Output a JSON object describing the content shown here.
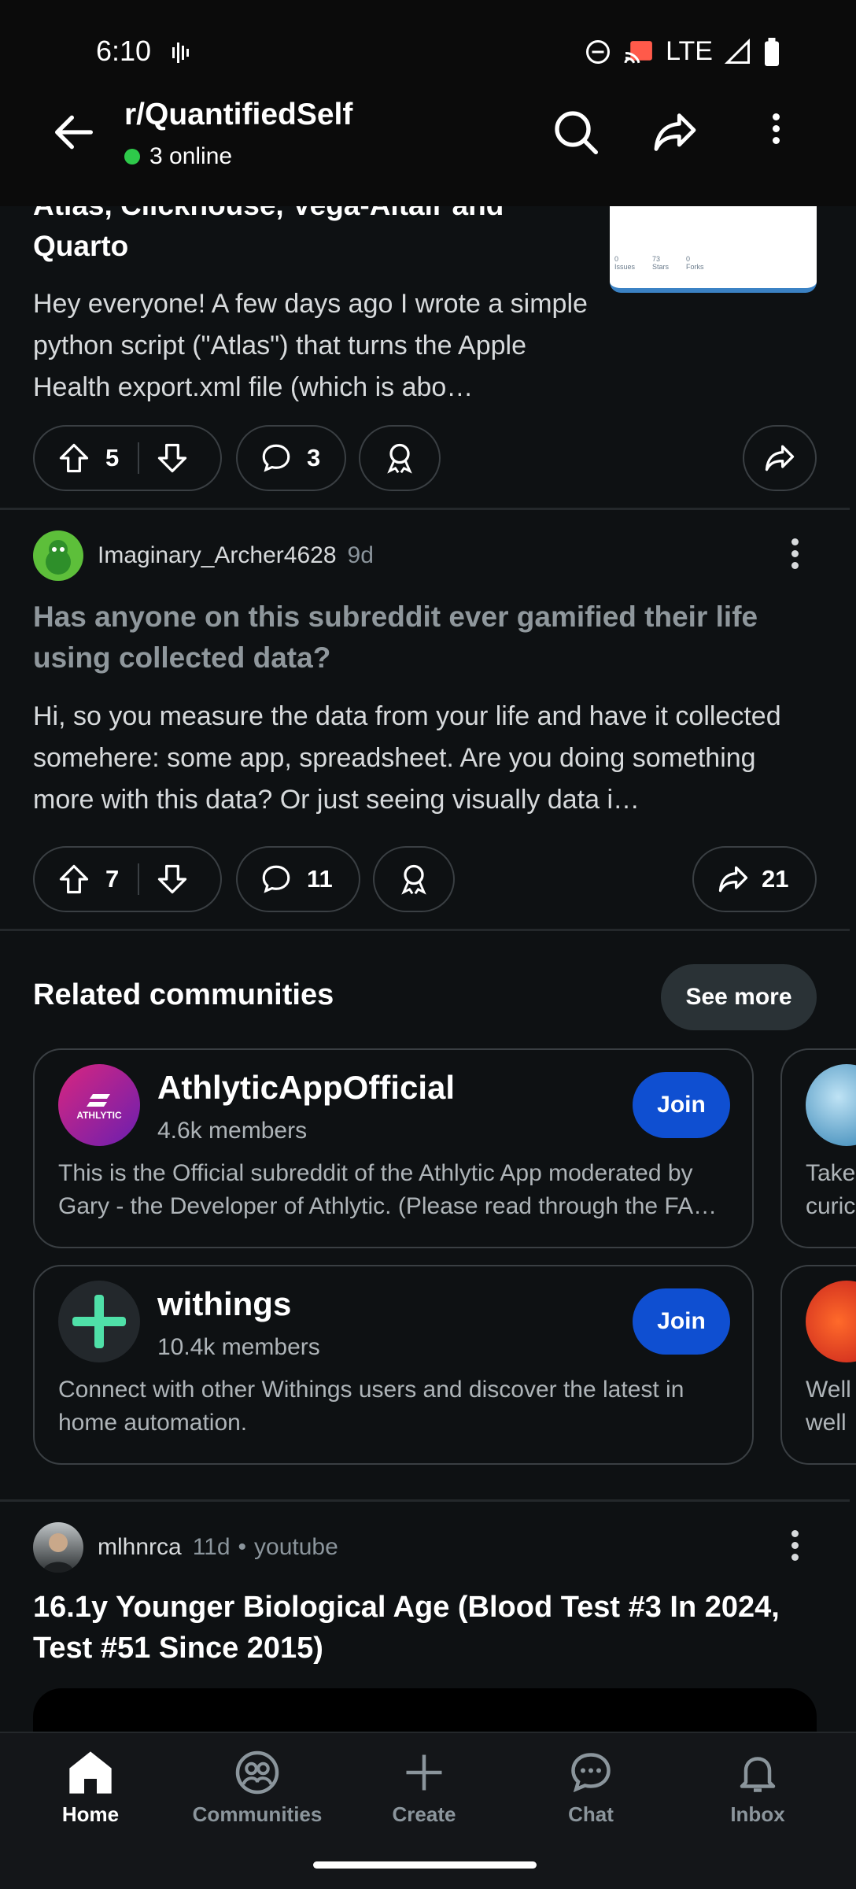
{
  "status": {
    "time": "6:10",
    "network": "LTE"
  },
  "header": {
    "title": "r/QuantifiedSelf",
    "online": "3 online"
  },
  "post1": {
    "title_visible": "Atlas, Clickhouse, Vega-Altair and",
    "title_line2": "Quarto",
    "body": "Hey everyone! A few days ago I wrote a simple python script (\"Atlas\") that turns the Apple Health export.xml file (which is abo…",
    "upvotes": "5",
    "comments": "3",
    "thumb_meta": {
      "a": "0",
      "b": "73",
      "c": "0",
      "l1": "Issues",
      "l2": "Stars",
      "l3": "Forks"
    }
  },
  "post2": {
    "user": "Imaginary_Archer4628",
    "age": "9d",
    "title": "Has anyone on this subreddit ever gamified their life using collected data?",
    "body": "Hi, so you measure the data from your life and have it collected somehere: some app, spreadsheet. Are you doing something more with this data? Or just seeing visually data i…",
    "upvotes": "7",
    "comments": "11",
    "shares": "21"
  },
  "related": {
    "title": "Related communities",
    "see_more": "See more",
    "communities": [
      {
        "name": "AthlyticAppOfficial",
        "members": "4.6k members",
        "desc": "This is the Official subreddit of the Athlytic App moderated by Gary - the Developer of Athlytic.  (Please read through the FA…",
        "join": "Join",
        "logo_text": "ATHLYTIC"
      },
      {
        "name": "withings",
        "members": "10.4k members",
        "desc": "Connect with other Withings users and discover the latest in home automation.",
        "join": "Join"
      }
    ],
    "peek": [
      {
        "line1": "Take",
        "line2": "curic"
      },
      {
        "line1": "Well",
        "line2": "well"
      }
    ]
  },
  "post3": {
    "user": "mlhnrca",
    "age": "11d",
    "source": "youtube",
    "title": "16.1y Younger Biological Age (Blood Test #3 In 2024, Test #51 Since 2015)"
  },
  "nav": {
    "items": [
      {
        "label": "Home"
      },
      {
        "label": "Communities"
      },
      {
        "label": "Create"
      },
      {
        "label": "Chat"
      },
      {
        "label": "Inbox"
      }
    ]
  }
}
